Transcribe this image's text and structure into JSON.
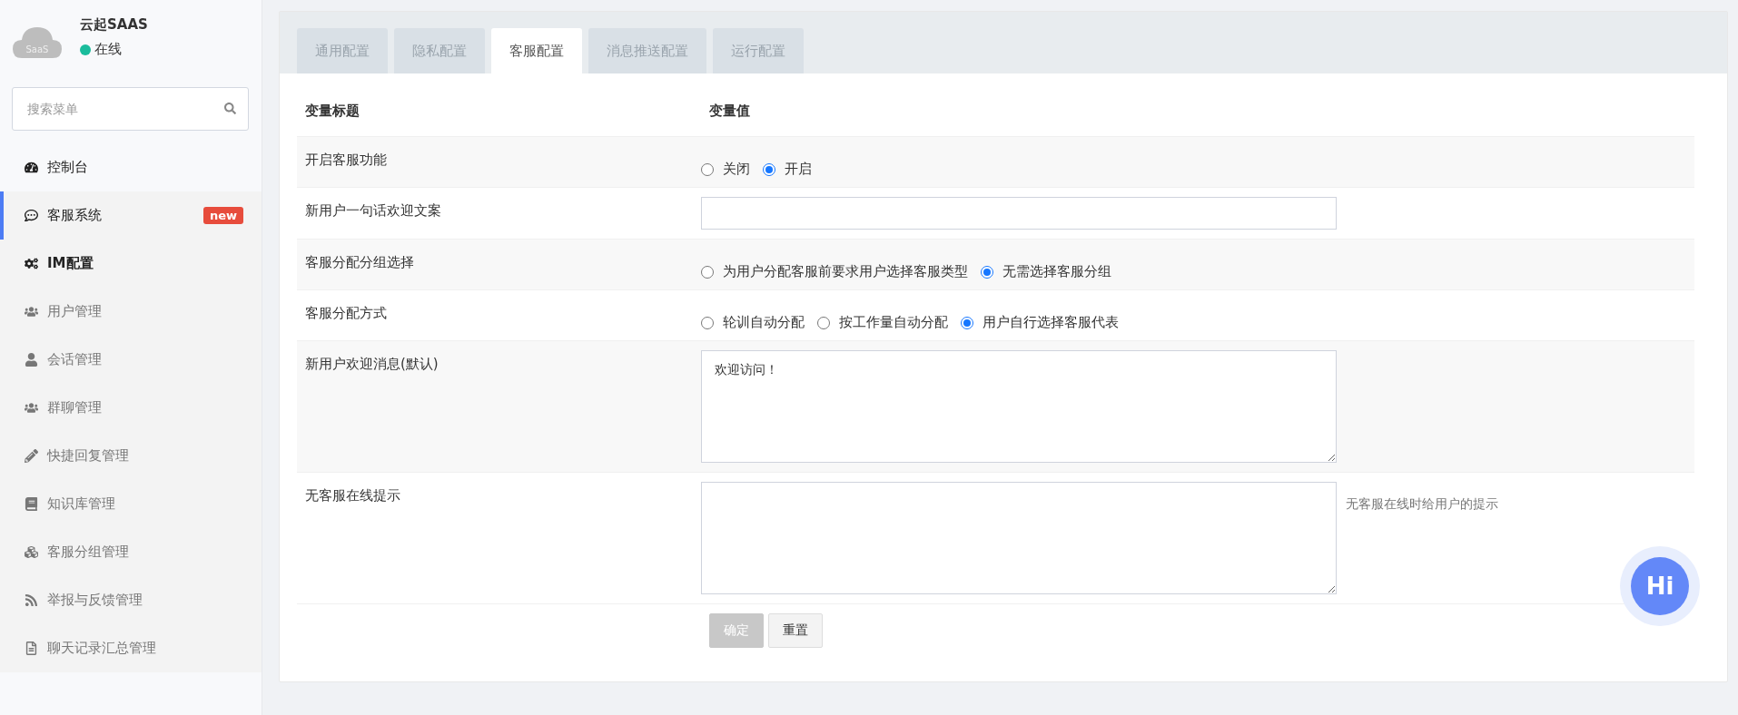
{
  "brand": {
    "logo_text": "SaaS",
    "name": "云起SAAS",
    "status": "在线",
    "online": true
  },
  "search": {
    "placeholder": "搜索菜单"
  },
  "menu": [
    {
      "label": "控制台",
      "kind": "link",
      "selected": false
    },
    {
      "label": "客服系统",
      "kind": "group",
      "selected": true,
      "badge": "new"
    },
    {
      "label": "IM配置",
      "kind": "heading",
      "selected": false
    },
    {
      "label": "用户管理",
      "kind": "item",
      "selected": false
    },
    {
      "label": "会话管理",
      "kind": "item",
      "selected": false
    },
    {
      "label": "群聊管理",
      "kind": "item",
      "selected": false
    },
    {
      "label": "快捷回复管理",
      "kind": "item",
      "selected": false
    },
    {
      "label": "知识库管理",
      "kind": "item",
      "selected": false
    },
    {
      "label": "客服分组管理",
      "kind": "item",
      "selected": false
    },
    {
      "label": "举报与反馈管理",
      "kind": "item",
      "selected": false
    },
    {
      "label": "聊天记录汇总管理",
      "kind": "item",
      "selected": false
    }
  ],
  "tabs": [
    {
      "label": "通用配置",
      "selected": false
    },
    {
      "label": "隐私配置",
      "selected": false
    },
    {
      "label": "客服配置",
      "selected": true
    },
    {
      "label": "消息推送配置",
      "selected": false
    },
    {
      "label": "运行配置",
      "selected": false
    }
  ],
  "table": {
    "columns": [
      "变量标题",
      "变量值"
    ],
    "rows": [
      {
        "label": "开启客服功能",
        "kind": "radio",
        "options": [
          {
            "label": "关闭",
            "selected": false
          },
          {
            "label": "开启",
            "selected": true
          }
        ]
      },
      {
        "label": "新用户一句话欢迎文案",
        "kind": "text"
      },
      {
        "label": "客服分配分组选择",
        "kind": "radio",
        "options": [
          {
            "label": "为用户分配客服前要求用户选择客服类型",
            "selected": false
          },
          {
            "label": "无需选择客服分组",
            "selected": true
          }
        ]
      },
      {
        "label": "客服分配方式",
        "kind": "radio",
        "options": [
          {
            "label": "轮训自动分配",
            "selected": false
          },
          {
            "label": "按工作量自动分配",
            "selected": false
          },
          {
            "label": "用户自行选择客服代表",
            "selected": true
          }
        ]
      },
      {
        "label": "新用户欢迎消息(默认)",
        "kind": "textarea",
        "value": "欢迎访问！"
      },
      {
        "label": "无客服在线提示",
        "kind": "textarea",
        "hint": "无客服在线时给用户的提示"
      }
    ]
  },
  "buttons": [
    {
      "label": "确定",
      "kind": "primary",
      "disabled": true
    },
    {
      "label": "重置",
      "kind": "default",
      "disabled": false
    }
  ],
  "float_button": {
    "label": "Hi"
  }
}
